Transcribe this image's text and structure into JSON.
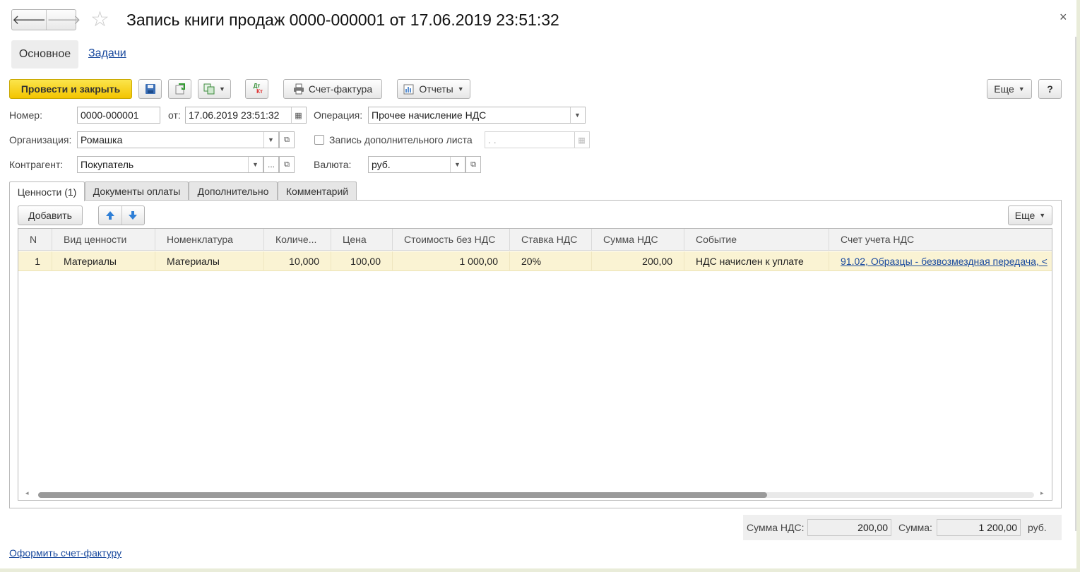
{
  "window": {
    "title": "Запись книги продаж 0000-000001 от 17.06.2019 23:51:32",
    "close_glyph": "×",
    "back_glyph": "🡐",
    "forward_glyph": "🡒",
    "star_glyph": "☆"
  },
  "sections": {
    "main": "Основное",
    "tasks": "Задачи"
  },
  "toolbar": {
    "post_close": "Провести и закрыть",
    "invoice": "Счет-фактура",
    "reports": "Отчеты",
    "more": "Еще",
    "help": "?",
    "dt_label": "Дт",
    "kt_label": "Кт"
  },
  "form": {
    "number_label": "Номер:",
    "number_value": "0000-000001",
    "from_label": "от:",
    "date_value": "17.06.2019 23:51:32",
    "operation_label": "Операция:",
    "operation_value": "Прочее начисление НДС",
    "org_label": "Организация:",
    "org_value": "Ромашка",
    "extra_sheet_label": "Запись дополнительного листа",
    "extra_sheet_date": " .  .",
    "counterparty_label": "Контрагент:",
    "counterparty_value": "Покупатель",
    "currency_label": "Валюта:",
    "currency_value": "руб."
  },
  "tabs": [
    {
      "label": "Ценности (1)"
    },
    {
      "label": "Документы оплаты"
    },
    {
      "label": "Дополнительно"
    },
    {
      "label": "Комментарий"
    }
  ],
  "table_toolbar": {
    "add": "Добавить",
    "more": "Еще"
  },
  "table": {
    "columns": [
      "N",
      "Вид ценности",
      "Номенклатура",
      "Количе...",
      "Цена",
      "Стоимость без НДС",
      "Ставка НДС",
      "Сумма НДС",
      "Событие",
      "Счет учета НДС"
    ],
    "rows": [
      [
        "1",
        "Материалы",
        "Материалы",
        "10,000",
        "100,00",
        "1 000,00",
        "20%",
        "200,00",
        "НДС начислен к уплате",
        "91.02, Образцы - безвозмездная передача, <"
      ]
    ]
  },
  "totals": {
    "vat_label": "Сумма НДС:",
    "vat_value": "200,00",
    "sum_label": "Сумма:",
    "sum_value": "1 200,00",
    "currency": "руб."
  },
  "footer": {
    "make_invoice": "Оформить счет-фактуру"
  },
  "colors": {
    "primary_button": "#f5c800",
    "selected_row": "#faf3d3",
    "link": "#1a4a9e"
  }
}
